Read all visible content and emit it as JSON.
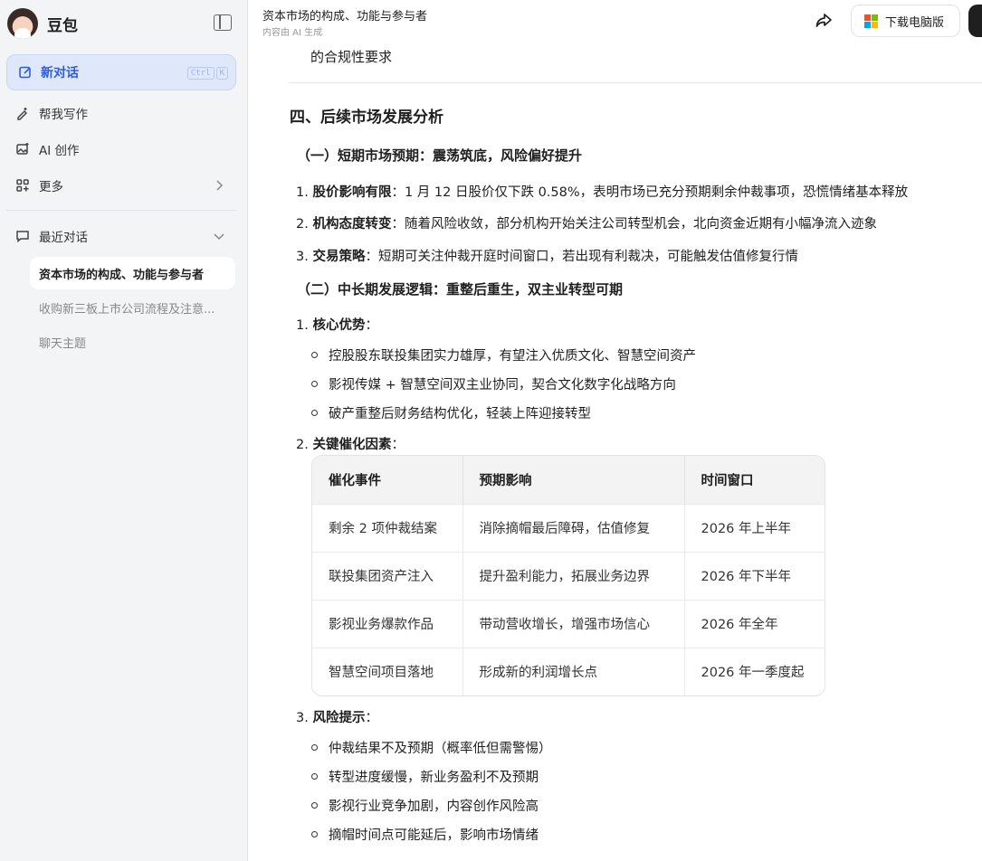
{
  "sidebar": {
    "brand": "豆包",
    "new_chat": "新对话",
    "shortcut": [
      "Ctrl",
      "K"
    ],
    "nav": [
      {
        "label": "帮我写作",
        "icon": "pen-sparkle-icon"
      },
      {
        "label": "AI 创作",
        "icon": "image-sparkle-icon"
      },
      {
        "label": "更多",
        "icon": "apps-grid-icon"
      }
    ],
    "recent_label": "最近对话",
    "history": [
      "资本市场的构成、功能与参与者",
      "收购新三板上市公司流程及注意...",
      "聊天主题"
    ]
  },
  "header": {
    "title": "资本市场的构成、功能与参与者",
    "subtitle": "内容由 AI 生成",
    "download": "下载电脑版"
  },
  "content": {
    "prev_text": "的合规性要求",
    "section_title": "四、后续市场发展分析",
    "sub1": "（一）短期市场预期：震荡筑底，风险偏好提升",
    "short_items": [
      {
        "num": "1.",
        "title": "股价影响有限",
        "text": "：1 月 12 日股价仅下跌 0.58%，表明市场已充分预期剩余仲裁事项，恐慌情绪基本释放"
      },
      {
        "num": "2.",
        "title": "机构态度转变",
        "text": "：随着风险收敛，部分机构开始关注公司转型机会，北向资金近期有小幅净流入迹象"
      },
      {
        "num": "3.",
        "title": "交易策略",
        "text": "：短期可关注仲裁开庭时间窗口，若出现有利裁决，可能触发估值修复行情"
      }
    ],
    "sub2": "（二）中长期发展逻辑：重整后重生，双主业转型可期",
    "adv": {
      "num": "1.",
      "title": "核心优势",
      "suffix": "："
    },
    "adv_bullets": [
      "控股股东联投集团实力雄厚，有望注入优质文化、智慧空间资产",
      "影视传媒 + 智慧空间双主业协同，契合文化数字化战略方向",
      "破产重整后财务结构优化，轻装上阵迎接转型"
    ],
    "cat": {
      "num": "2.",
      "title": "关键催化因素",
      "suffix": "："
    },
    "table": {
      "headers": [
        "催化事件",
        "预期影响",
        "时间窗口"
      ],
      "rows": [
        [
          "剩余 2 项仲裁结案",
          "消除摘帽最后障碍，估值修复",
          "2026 年上半年"
        ],
        [
          "联投集团资产注入",
          "提升盈利能力，拓展业务边界",
          "2026 年下半年"
        ],
        [
          "影视业务爆款作品",
          "带动营收增长，增强市场信心",
          "2026 年全年"
        ],
        [
          "智慧空间项目落地",
          "形成新的利润增长点",
          "2026 年一季度起"
        ]
      ]
    },
    "risk": {
      "num": "3.",
      "title": "风险提示",
      "suffix": "："
    },
    "risk_bullets": [
      "仲裁结果不及预期（概率低但需警惕）",
      "转型进度缓慢，新业务盈利不及预期",
      "影视行业竞争加剧，内容创作风险高",
      "摘帽时间点可能延后，影响市场情绪"
    ]
  },
  "colors": {
    "accent": "#2f5dd8",
    "sidebar_bg": "#f3f4f6",
    "active_bg": "#dfe8fb"
  }
}
